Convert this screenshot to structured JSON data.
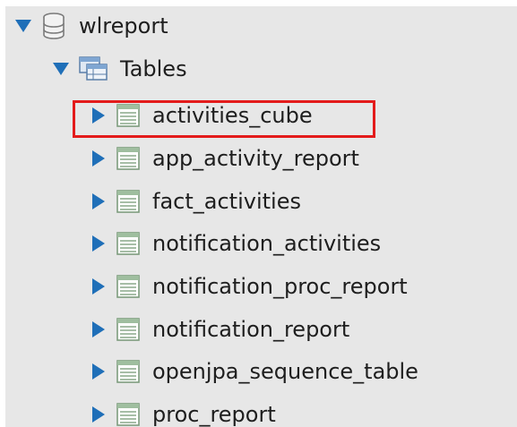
{
  "tree": {
    "database": {
      "label": "wlreport",
      "expanded": true,
      "icon": "database-icon"
    },
    "tables_folder": {
      "label": "Tables",
      "expanded": true,
      "icon": "tables-folder-icon"
    },
    "tables": [
      {
        "label": "activities_cube",
        "icon": "table-icon",
        "highlighted": true
      },
      {
        "label": "app_activity_report",
        "icon": "table-icon"
      },
      {
        "label": "fact_activities",
        "icon": "table-icon"
      },
      {
        "label": "notification_activities",
        "icon": "table-icon"
      },
      {
        "label": "notification_proc_report",
        "icon": "table-icon"
      },
      {
        "label": "notification_report",
        "icon": "table-icon"
      },
      {
        "label": "openjpa_sequence_table",
        "icon": "table-icon"
      },
      {
        "label": "proc_report",
        "icon": "table-icon"
      }
    ]
  },
  "colors": {
    "panel_bg": "#e7e7e7",
    "expander": "#1f6fb8",
    "highlight_border": "#e31b1b"
  }
}
